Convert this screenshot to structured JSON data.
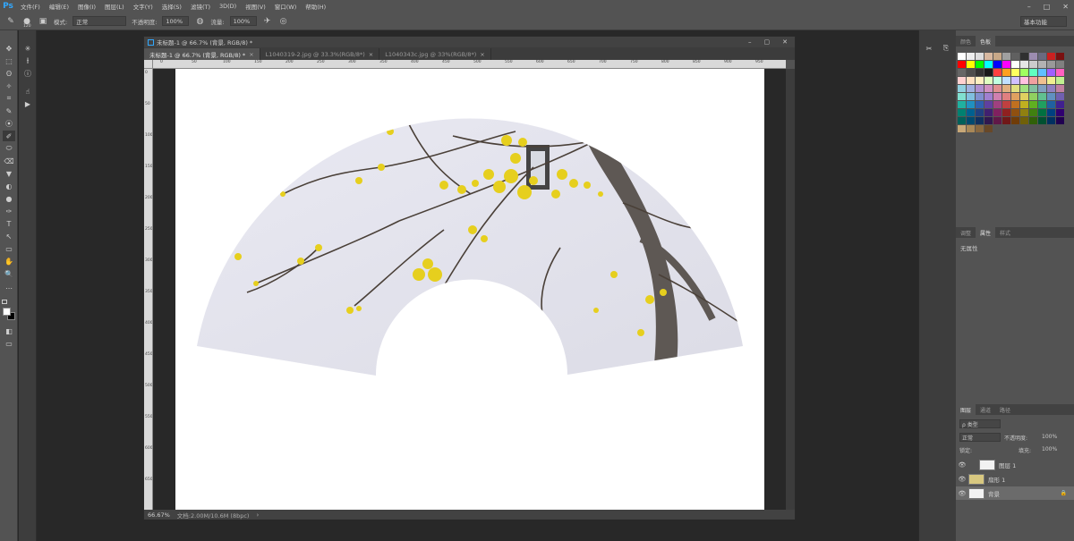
{
  "menubar": {
    "logo": "Ps",
    "items": [
      "文件(F)",
      "编辑(E)",
      "图像(I)",
      "图层(L)",
      "文字(Y)",
      "选择(S)",
      "滤镜(T)",
      "3D(D)",
      "视图(V)",
      "窗口(W)",
      "帮助(H)"
    ],
    "window_controls": [
      "–",
      "□",
      "✕"
    ]
  },
  "options": {
    "size": "120",
    "mode_label": "模式:",
    "mode_value": "正常",
    "opacity_label": "不透明度:",
    "opacity_value": "100%",
    "flow_label": "流量:",
    "flow_value": "100%",
    "workspace": "基本功能"
  },
  "tools": {
    "left": [
      "✥",
      "⬚",
      "ʘ",
      "✧",
      "⌗",
      "✎",
      "⦿",
      "✐",
      "⬭",
      "⌫",
      "▼",
      "◐",
      "●",
      "✑",
      "T",
      "↖",
      "▭",
      "✋",
      "🔍",
      "⋯"
    ],
    "secondary": [
      "✳",
      "⫲",
      "ⓘ",
      "☝",
      "▶"
    ]
  },
  "document": {
    "title": "未标题-1 @ 66.7% (背景, RGB/8) *",
    "window_controls": [
      "–",
      "▢",
      "✕"
    ],
    "tabs": [
      {
        "label": "未标题-1 @ 66.7% (背景, RGB/8) *",
        "active": true
      },
      {
        "label": "L1040319-2.jpg @ 33.3%(RGB/8*)",
        "active": false
      },
      {
        "label": "L1040343c.jpg @ 33%(RGB/8*)",
        "active": false
      }
    ],
    "tab_close": "×",
    "ruler_h": [
      "0",
      "50",
      "100",
      "150",
      "200",
      "250",
      "300",
      "350",
      "400",
      "450",
      "500",
      "550",
      "600",
      "650",
      "700",
      "750",
      "800",
      "850",
      "900",
      "950"
    ],
    "ruler_v": [
      "0",
      "50",
      "100",
      "150",
      "200",
      "250",
      "300",
      "350",
      "400",
      "450",
      "500",
      "550",
      "600",
      "650"
    ],
    "status_zoom": "66.67%",
    "status_info": "文档:2.00M/10.6M (8bpc)",
    "status_arrow": "›"
  },
  "swatches": {
    "tabs": [
      "颜色",
      "色板"
    ],
    "colors": [
      "#ffffff",
      "#eeeeee",
      "#dddddd",
      "#d8b8a0",
      "#c8a888",
      "#a0a0a0",
      "#606060",
      "#303030",
      "#9c8cb0",
      "#6a6a80",
      "#cc2020",
      "#7a1010",
      "#ff0000",
      "#ffff00",
      "#00ff00",
      "#00ffff",
      "#0000ff",
      "#ff00ff",
      "#ffffff",
      "#e6e6e6",
      "#cccccc",
      "#b3b3b3",
      "#999999",
      "#808080",
      "#666666",
      "#4d4d4d",
      "#333333",
      "#1a1a1a",
      "#ff4040",
      "#ffa020",
      "#ffff60",
      "#a0ff60",
      "#60ffc0",
      "#60c0ff",
      "#a060ff",
      "#ff60c0",
      "#ffd0d0",
      "#ffe0c0",
      "#fff0c0",
      "#e0ffc0",
      "#c0ffe0",
      "#c0e0ff",
      "#d0c0ff",
      "#ffc0e0",
      "#f0a0a0",
      "#f0c090",
      "#f0f090",
      "#c0f090",
      "#90d0e0",
      "#a0b0e0",
      "#b090d0",
      "#d090c0",
      "#e09090",
      "#e0b080",
      "#e0e080",
      "#a0e080",
      "#80c0a0",
      "#80a0c0",
      "#9080c0",
      "#c080a0",
      "#80e0d0",
      "#80c0e0",
      "#8090d0",
      "#a080d0",
      "#d080b0",
      "#e08080",
      "#e0a060",
      "#e0d060",
      "#90d060",
      "#60c090",
      "#6090c0",
      "#7060b0",
      "#20b0a0",
      "#2090c0",
      "#3060b0",
      "#6040a0",
      "#a04080",
      "#c04040",
      "#c07020",
      "#c0b020",
      "#60b020",
      "#20a060",
      "#2060a0",
      "#402090",
      "#008070",
      "#006090",
      "#204080",
      "#402070",
      "#802060",
      "#902020",
      "#905010",
      "#908010",
      "#408010",
      "#007040",
      "#004080",
      "#300070",
      "#00605a",
      "#004a70",
      "#103060",
      "#301850",
      "#601848",
      "#701818",
      "#703c08",
      "#706008",
      "#306008",
      "#005030",
      "#003060",
      "#200050",
      "#c8a878",
      "#a88858",
      "#886840",
      "#684828"
    ]
  },
  "adjustments": {
    "tabs": [
      "调整",
      "属性",
      "样式"
    ],
    "content": "无属性"
  },
  "layers": {
    "tabs": [
      "图层",
      "通道",
      "路径"
    ],
    "filter_label": "ρ 类型",
    "blend_mode": "正常",
    "opacity_label": "不透明度:",
    "opacity_value": "100%",
    "lock_label": "锁定:",
    "fill_label": "填充:",
    "fill_value": "100%",
    "items": [
      {
        "name": "图层 1",
        "selected": false
      },
      {
        "name": "扇形 1",
        "selected": false
      },
      {
        "name": "背景",
        "selected": true
      }
    ],
    "eye": "👁",
    "lock": "🔒"
  }
}
